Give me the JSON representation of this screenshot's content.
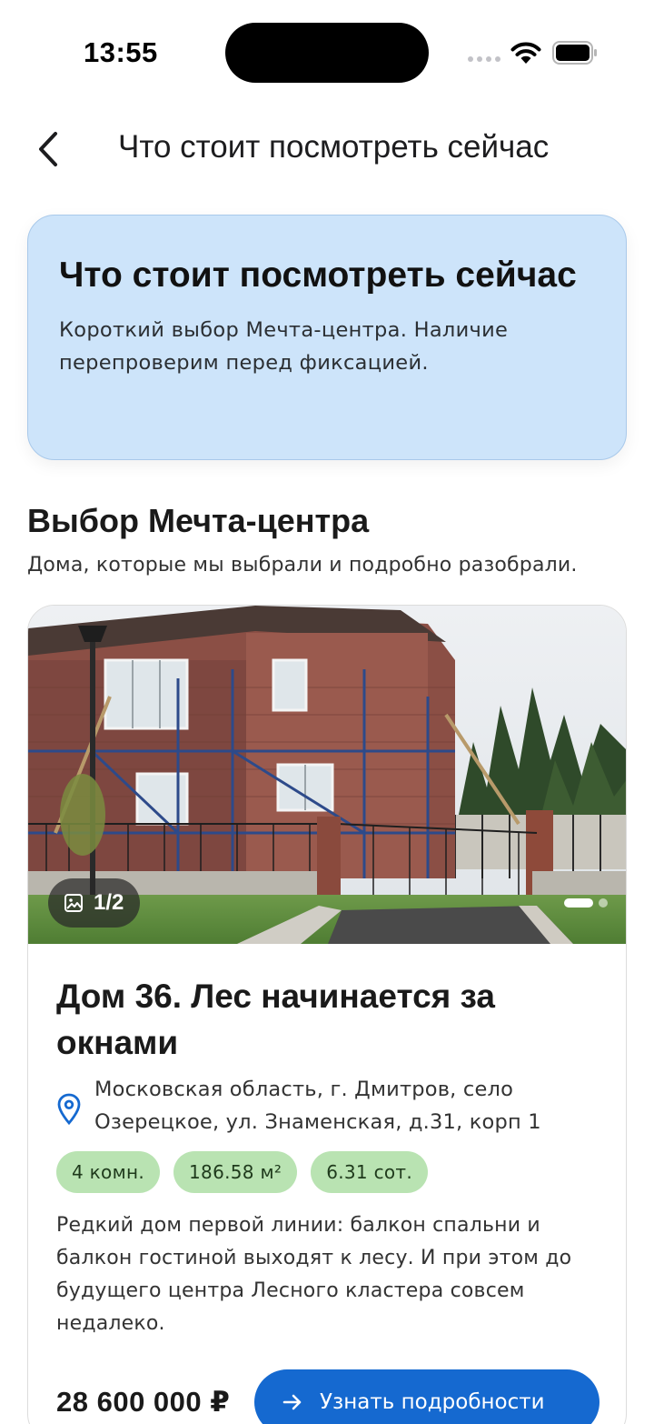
{
  "status_bar": {
    "time": "13:55"
  },
  "nav": {
    "title": "Что стоит посмотреть сейчас",
    "back_icon": "chevron-left-icon"
  },
  "hero": {
    "title": "Что стоит посмотреть сейчас",
    "subtitle": "Короткий выбор Мечта-центра. Наличие перепроверим перед фиксацией."
  },
  "section": {
    "title": "Выбор Мечта-центра",
    "subtitle": "Дома, которые мы выбрали и подробно разобрали."
  },
  "listing": {
    "photo_counter": "1/2",
    "photo_index": 1,
    "photo_total": 2,
    "title": "Дом 36. Лес начинается за окнами",
    "address": "Московская область, г. Дмитров, село Озерецкое, ул. Знаменская, д.31, корп 1",
    "chips": [
      "4 комн.",
      "186.58 м²",
      "6.31 сот."
    ],
    "description": "Редкий дом первой линии: балкон спальни и балкон гостиной выходят к лесу. И при этом до будущего центра Лесного кластера совсем недалеко.",
    "price": "28 600 000 ₽",
    "cta_label": "Узнать подробности"
  },
  "colors": {
    "hero_bg": "#cde4fa",
    "chip_bg": "#b9e3b2",
    "button_bg": "#1569d0",
    "pin": "#1569d0"
  }
}
